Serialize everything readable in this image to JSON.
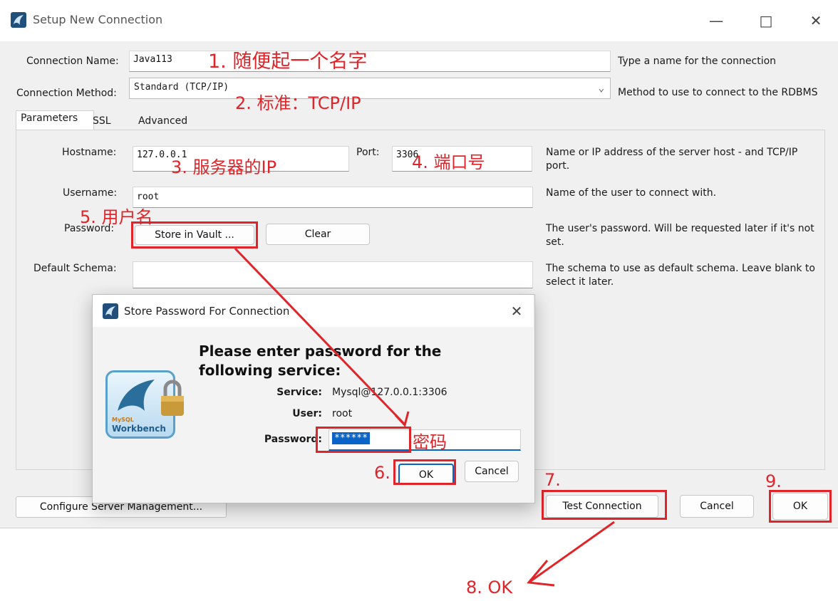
{
  "window": {
    "title": "Setup New Connection"
  },
  "form": {
    "connection_name_label": "Connection Name:",
    "connection_name_value": "Java113",
    "connection_name_hint": "Type a name for the connection",
    "connection_method_label": "Connection Method:",
    "connection_method_value": "Standard (TCP/IP)",
    "connection_method_hint": "Method to use to connect to the RDBMS"
  },
  "tabs": [
    {
      "label": "Parameters"
    },
    {
      "label": "SSL"
    },
    {
      "label": "Advanced"
    }
  ],
  "params": {
    "hostname_label": "Hostname:",
    "hostname_value": "127.0.0.1",
    "port_label": "Port:",
    "port_value": "3306",
    "host_hint": "Name or IP address of the server host - and TCP/IP port.",
    "username_label": "Username:",
    "username_value": "root",
    "username_hint": "Name of the user to connect with.",
    "password_label": "Password:",
    "store_vault_label": "Store in Vault ...",
    "clear_label": "Clear",
    "password_hint": "The user's password. Will be requested later if it's not set.",
    "schema_label": "Default Schema:",
    "schema_value": "",
    "schema_hint": "The schema to use as default schema. Leave blank to select it later."
  },
  "footer": {
    "configure_label": "Configure Server Management...",
    "test_label": "Test Connection",
    "cancel_label": "Cancel",
    "ok_label": "OK"
  },
  "dialog": {
    "title": "Store Password For Connection",
    "heading": "Please enter password for the following service:",
    "service_label": "Service:",
    "service_value": "Mysql@127.0.0.1:3306",
    "user_label": "User:",
    "user_value": "root",
    "password_label": "Password:",
    "password_value": "******",
    "ok_label": "OK",
    "cancel_label": "Cancel",
    "logo_text": "Workbench",
    "logo_small": "MySQL"
  },
  "annotations": {
    "a1": "1. 随便起一个名字",
    "a2": "2. 标准：TCP/IP",
    "a3": "3. 服务器的IP",
    "a4": "4. 端口号",
    "a5": "5. 用户名",
    "pwd": "密码",
    "a6": "6.",
    "a7": "7.",
    "a8": "8. OK",
    "a9": "9."
  },
  "colors": {
    "annotation": "#e0252a",
    "selection": "#0a64c8"
  }
}
